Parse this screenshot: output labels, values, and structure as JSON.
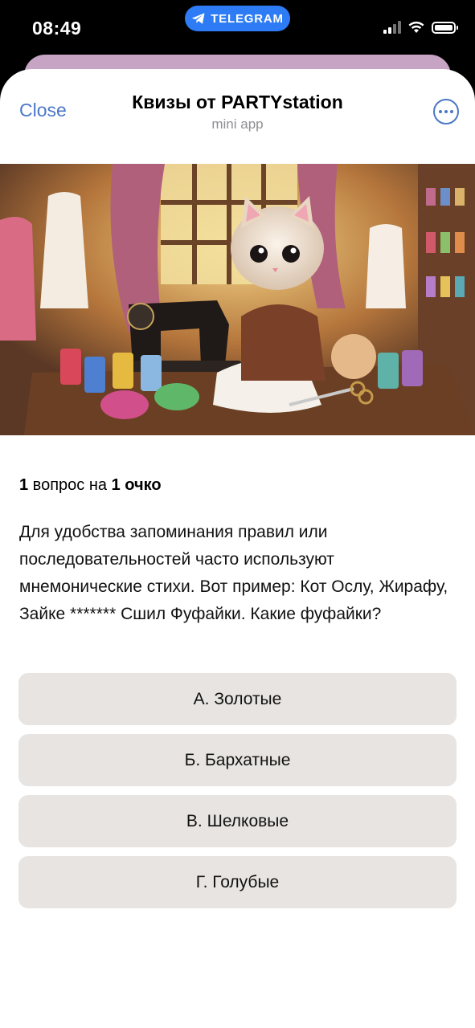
{
  "status_bar": {
    "time": "08:49",
    "app_pill_label": "TELEGRAM",
    "pill_color": "#2d7cf6"
  },
  "header": {
    "close_label": "Close",
    "title": "Квизы от PARTYstation",
    "subtitle": "mini app",
    "more_icon": "more-horizontal-icon",
    "accent_color": "#4b77c6"
  },
  "hero": {
    "icon": "kitten-sewing-illustration"
  },
  "quiz": {
    "question_count": "1",
    "points_middle": " вопрос на ",
    "points": "1 очко",
    "question": "Для удобства запоминания правил или последовательностей часто используют мнемонические стихи. Вот пример: Кот Ослу, Жирафу, Зайке ******* Сшил Фуфайки. Какие фуфайки?",
    "answers": [
      {
        "label": "А. Золотые"
      },
      {
        "label": "Б. Бархатные"
      },
      {
        "label": "В. Шелковые"
      },
      {
        "label": "Г. Голубые"
      }
    ],
    "answer_bg": "#e7e4e1"
  }
}
